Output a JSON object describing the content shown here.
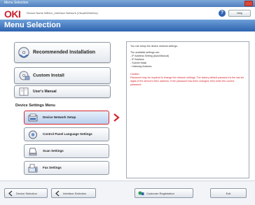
{
  "window": {
    "title": "Menu Selection"
  },
  "header": {
    "logo": "OKI",
    "device_name": "Device Name MB4xx_interface Network (Visual/Wireless)",
    "help_label": "Help"
  },
  "menubar": {
    "title": "Menu Selection"
  },
  "main_buttons": [
    {
      "label": "Recommended Installation",
      "icon": "cd-install-icon"
    },
    {
      "label": "Custom Install",
      "icon": "custom-install-icon"
    },
    {
      "label": "User's Manual",
      "icon": "manual-icon"
    }
  ],
  "device_settings": {
    "heading": "Device Settings Menu",
    "items": [
      {
        "label": "Device Network Setup",
        "icon": "network-icon",
        "selected": true
      },
      {
        "label": "Control Panel Language Settings",
        "icon": "language-icon",
        "selected": false
      },
      {
        "label": "Scan Settings",
        "icon": "scanner-icon",
        "selected": false
      },
      {
        "label": "Fax Settings",
        "icon": "fax-icon",
        "selected": false
      }
    ]
  },
  "description": {
    "intro": "You can setup the device network settings.",
    "list_title": "The available settings are:",
    "list": [
      "- IP Address Setting (Auto/Manual)",
      "- IP Address",
      "- Subnet Mask",
      "- Gateway Address"
    ],
    "caution_title": "Caution:",
    "caution_text": "Password may be required to change the network settings. The factory default password is the last six digits of the device's MAC address. If the password has been changed, then enter the current password."
  },
  "footer": {
    "device_selection": "Device Selection",
    "interface_selection": "Interface Selection",
    "customer_registration": "Customer Registration",
    "exit": "Exit"
  },
  "colors": {
    "accent_blue": "#2e63b0",
    "brand_red": "#cc1f2d",
    "selection_border": "#d7262e"
  }
}
